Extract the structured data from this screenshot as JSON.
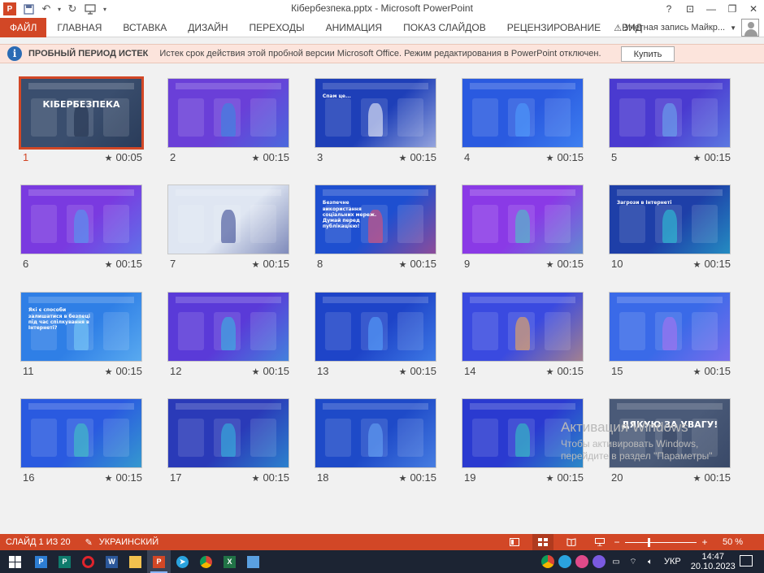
{
  "titlebar": {
    "title": "Кібербезпека.pptx - Microsoft PowerPoint",
    "app_logo": "P",
    "help": "?",
    "minimize": "—",
    "restore": "❐",
    "close": "✕",
    "ribbon_display": "⊡"
  },
  "ribbon": {
    "tabs": [
      "ФАЙЛ",
      "ГЛАВНАЯ",
      "ВСТАВКА",
      "ДИЗАЙН",
      "ПЕРЕХОДЫ",
      "АНИМАЦИЯ",
      "ПОКАЗ СЛАЙДОВ",
      "РЕЦЕНЗИРОВАНИЕ",
      "ВИД"
    ],
    "account_label": "Учетная запись Майкр..."
  },
  "banner": {
    "title": "ПРОБНЫЙ ПЕРИОД ИСТЕК",
    "message": "Истек срок действия этой пробной версии Microsoft Office. Режим редактирования в PowerPoint отключен.",
    "buy_label": "Купить"
  },
  "slides": [
    {
      "num": "1",
      "time": "00:05",
      "selected": true,
      "bg": "#3a4e6e",
      "accent": "#1c2c48"
    },
    {
      "num": "2",
      "time": "00:15",
      "bg": "#6a3fd8",
      "accent": "#2f8de0"
    },
    {
      "num": "3",
      "time": "00:15",
      "bg": "#1e3fb8",
      "accent": "#ffffff"
    },
    {
      "num": "4",
      "time": "00:15",
      "bg": "#2a5ae0",
      "accent": "#4fa0ff"
    },
    {
      "num": "5",
      "time": "00:15",
      "bg": "#4a3ad0",
      "accent": "#6bb0f0"
    },
    {
      "num": "6",
      "time": "00:15",
      "bg": "#7a3ae0",
      "accent": "#4aa0f0"
    },
    {
      "num": "7",
      "time": "00:15",
      "bg": "#dfe6f2",
      "accent": "#2a3a8a"
    },
    {
      "num": "8",
      "time": "00:15",
      "bg": "#1e4fd0",
      "accent": "#f04a6a"
    },
    {
      "num": "9",
      "time": "00:15",
      "bg": "#8a3ae6",
      "accent": "#3fd0c0"
    },
    {
      "num": "10",
      "time": "00:15",
      "bg": "#1e3fa8",
      "accent": "#2ad0d8"
    },
    {
      "num": "11",
      "time": "00:15",
      "bg": "#2f7fe6",
      "accent": "#7fd0f8"
    },
    {
      "num": "12",
      "time": "00:15",
      "bg": "#5a3ad8",
      "accent": "#2fc0e0"
    },
    {
      "num": "13",
      "time": "00:15",
      "bg": "#1e44c8",
      "accent": "#5aa8ff"
    },
    {
      "num": "14",
      "time": "00:15",
      "bg": "#3a4ae0",
      "accent": "#ffb04a"
    },
    {
      "num": "15",
      "time": "00:15",
      "bg": "#3a6ae8",
      "accent": "#b070f0"
    },
    {
      "num": "16",
      "time": "00:15",
      "bg": "#2a5ae0",
      "accent": "#3fd0c0"
    },
    {
      "num": "17",
      "time": "00:15",
      "bg": "#2a3ab8",
      "accent": "#2fc0e0"
    },
    {
      "num": "18",
      "time": "00:15",
      "bg": "#1e4ac8",
      "accent": "#6aaaf8"
    },
    {
      "num": "19",
      "time": "00:15",
      "bg": "#2a3ad0",
      "accent": "#2fd0c0"
    },
    {
      "num": "20",
      "time": "00:15",
      "bg": "#4a5a78",
      "accent": "#2a3a5a"
    }
  ],
  "slide_texts": {
    "s1_title": "КІБЕРБЕЗПЕКА",
    "s3_title": "Спам це...",
    "s8_title": "Безпечне використання соціальних мереж. Думай перед публікацією!",
    "s10_title": "Загрози в Інтернеті",
    "s11_title": "Які є способи залишатися в безпеці під час спілкування в Інтернеті?",
    "s20_title": "ДЯКУЮ ЗА УВАГУ!"
  },
  "activation": {
    "title": "Активация Windows",
    "line1": "Чтобы активировать Windows,",
    "line2": "перейдите в раздел \"Параметры\""
  },
  "statusbar": {
    "slide_info": "СЛАЙД 1 ИЗ 20",
    "language": "УКРАИНСКИЙ",
    "zoom_minus": "−",
    "zoom_plus": "+",
    "zoom_value": "50 %",
    "zoom_fraction": 0.5
  },
  "taskbar": {
    "lang": "УКР",
    "time": "14:47",
    "date": "20.10.2023"
  }
}
